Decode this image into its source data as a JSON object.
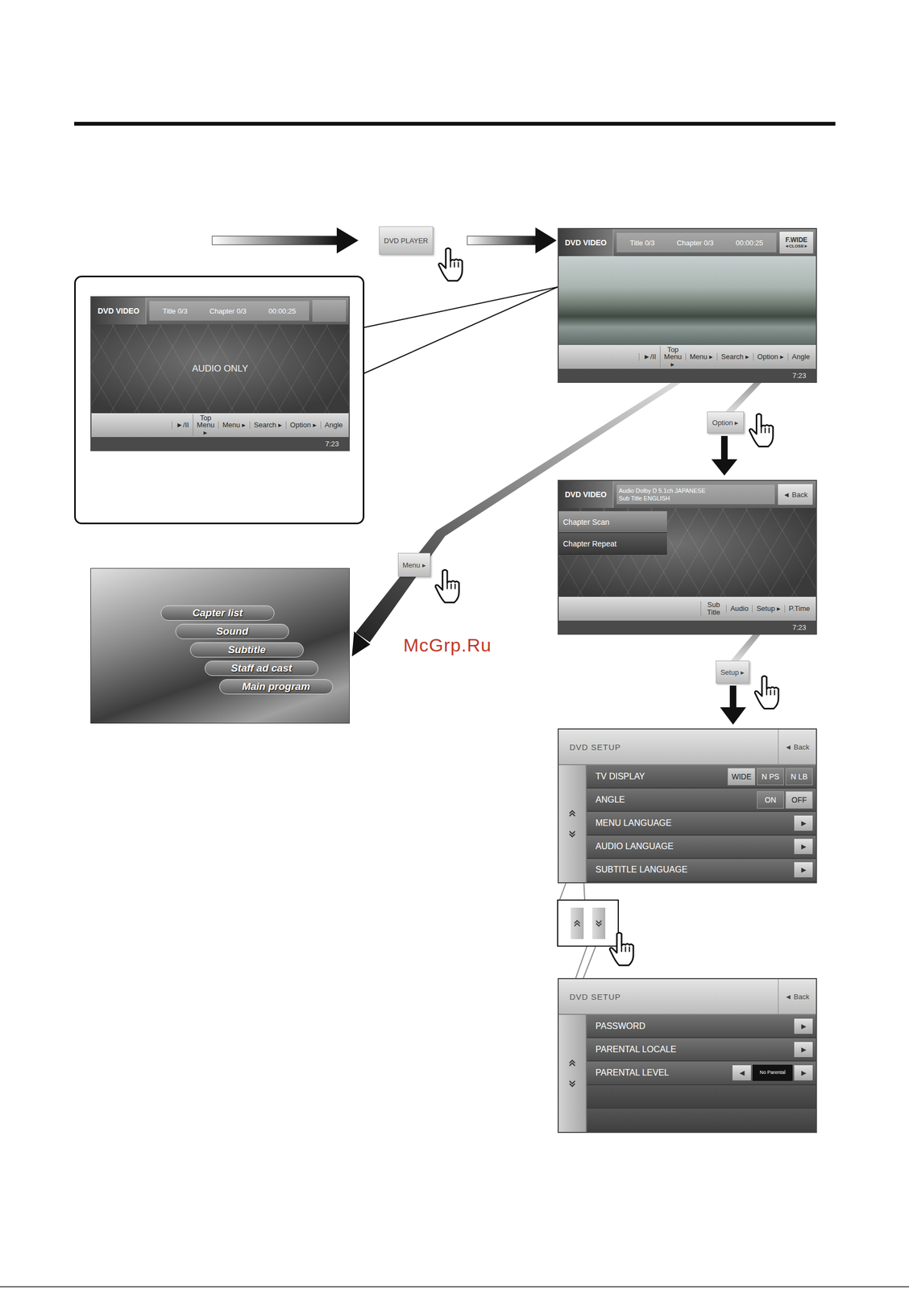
{
  "flow": {
    "dvd_player_button": "DVD PLAYER",
    "option_button": "Option ▸",
    "menu_button": "Menu ▸",
    "setup_button": "Setup ▸"
  },
  "playback_screen": {
    "source": "DVD VIDEO",
    "title": "Title 0/3",
    "chapter": "Chapter 0/3",
    "time": "00:00:25",
    "display_mode": "F.WIDE",
    "close": "◄CLOSE►",
    "controls": [
      "►/II",
      "Top Menu ▸",
      "Menu ▸",
      "Search ▸",
      "Option ▸",
      "Angle"
    ],
    "clock": "7:23"
  },
  "audio_only_screen": {
    "source": "DVD VIDEO",
    "title": "Title 0/3",
    "chapter": "Chapter 0/3",
    "time": "00:00:25",
    "message": "AUDIO ONLY",
    "controls": [
      "►/II",
      "Top Menu ▸",
      "Menu ▸",
      "Search ▸",
      "Option ▸",
      "Angle"
    ],
    "clock": "7:23"
  },
  "option_screen": {
    "source": "DVD VIDEO",
    "audio_info": "Audio Dolby D 5.1ch JAPANESE",
    "subtitle_info": "Sub Title ENGLISH",
    "back": "◄ Back",
    "items": [
      {
        "label": "Chapter Scan",
        "selected": true
      },
      {
        "label": "Chapter Repeat",
        "selected": false
      }
    ],
    "controls": [
      "Sub Title",
      "Audio",
      "Setup ▸",
      "P.Time"
    ],
    "clock": "7:23"
  },
  "disc_menu": {
    "items": [
      "Capter list",
      "Sound",
      "Subtitle",
      "Staff ad cast",
      "Main program"
    ]
  },
  "setup_screen_1": {
    "title": "DVD SETUP",
    "back": "◄ Back",
    "rows": [
      {
        "label": "TV DISPLAY",
        "kind": "choice",
        "options": [
          {
            "label": "WIDE",
            "selected": true
          },
          {
            "label": "N PS",
            "selected": false
          },
          {
            "label": "N LB",
            "selected": false
          }
        ]
      },
      {
        "label": "ANGLE",
        "kind": "choice",
        "options": [
          {
            "label": "ON",
            "selected": false
          },
          {
            "label": "OFF",
            "selected": true
          }
        ]
      },
      {
        "label": "MENU LANGUAGE",
        "kind": "submenu",
        "arrow": "▶"
      },
      {
        "label": "AUDIO LANGUAGE",
        "kind": "submenu",
        "arrow": "▶"
      },
      {
        "label": "SUBTITLE LANGUAGE",
        "kind": "submenu",
        "arrow": "▶"
      }
    ]
  },
  "setup_screen_2": {
    "title": "DVD SETUP",
    "back": "◄ Back",
    "rows": [
      {
        "label": "PASSWORD",
        "kind": "submenu",
        "arrow": "▶"
      },
      {
        "label": "PARENTAL LOCALE",
        "kind": "submenu",
        "arrow": "▶"
      },
      {
        "label": "PARENTAL LEVEL",
        "kind": "stepper",
        "prev": "◀",
        "value": "No Parental",
        "next": "▶"
      },
      {
        "kind": "empty"
      },
      {
        "kind": "empty"
      }
    ]
  },
  "watermark": "McGrp.Ru"
}
